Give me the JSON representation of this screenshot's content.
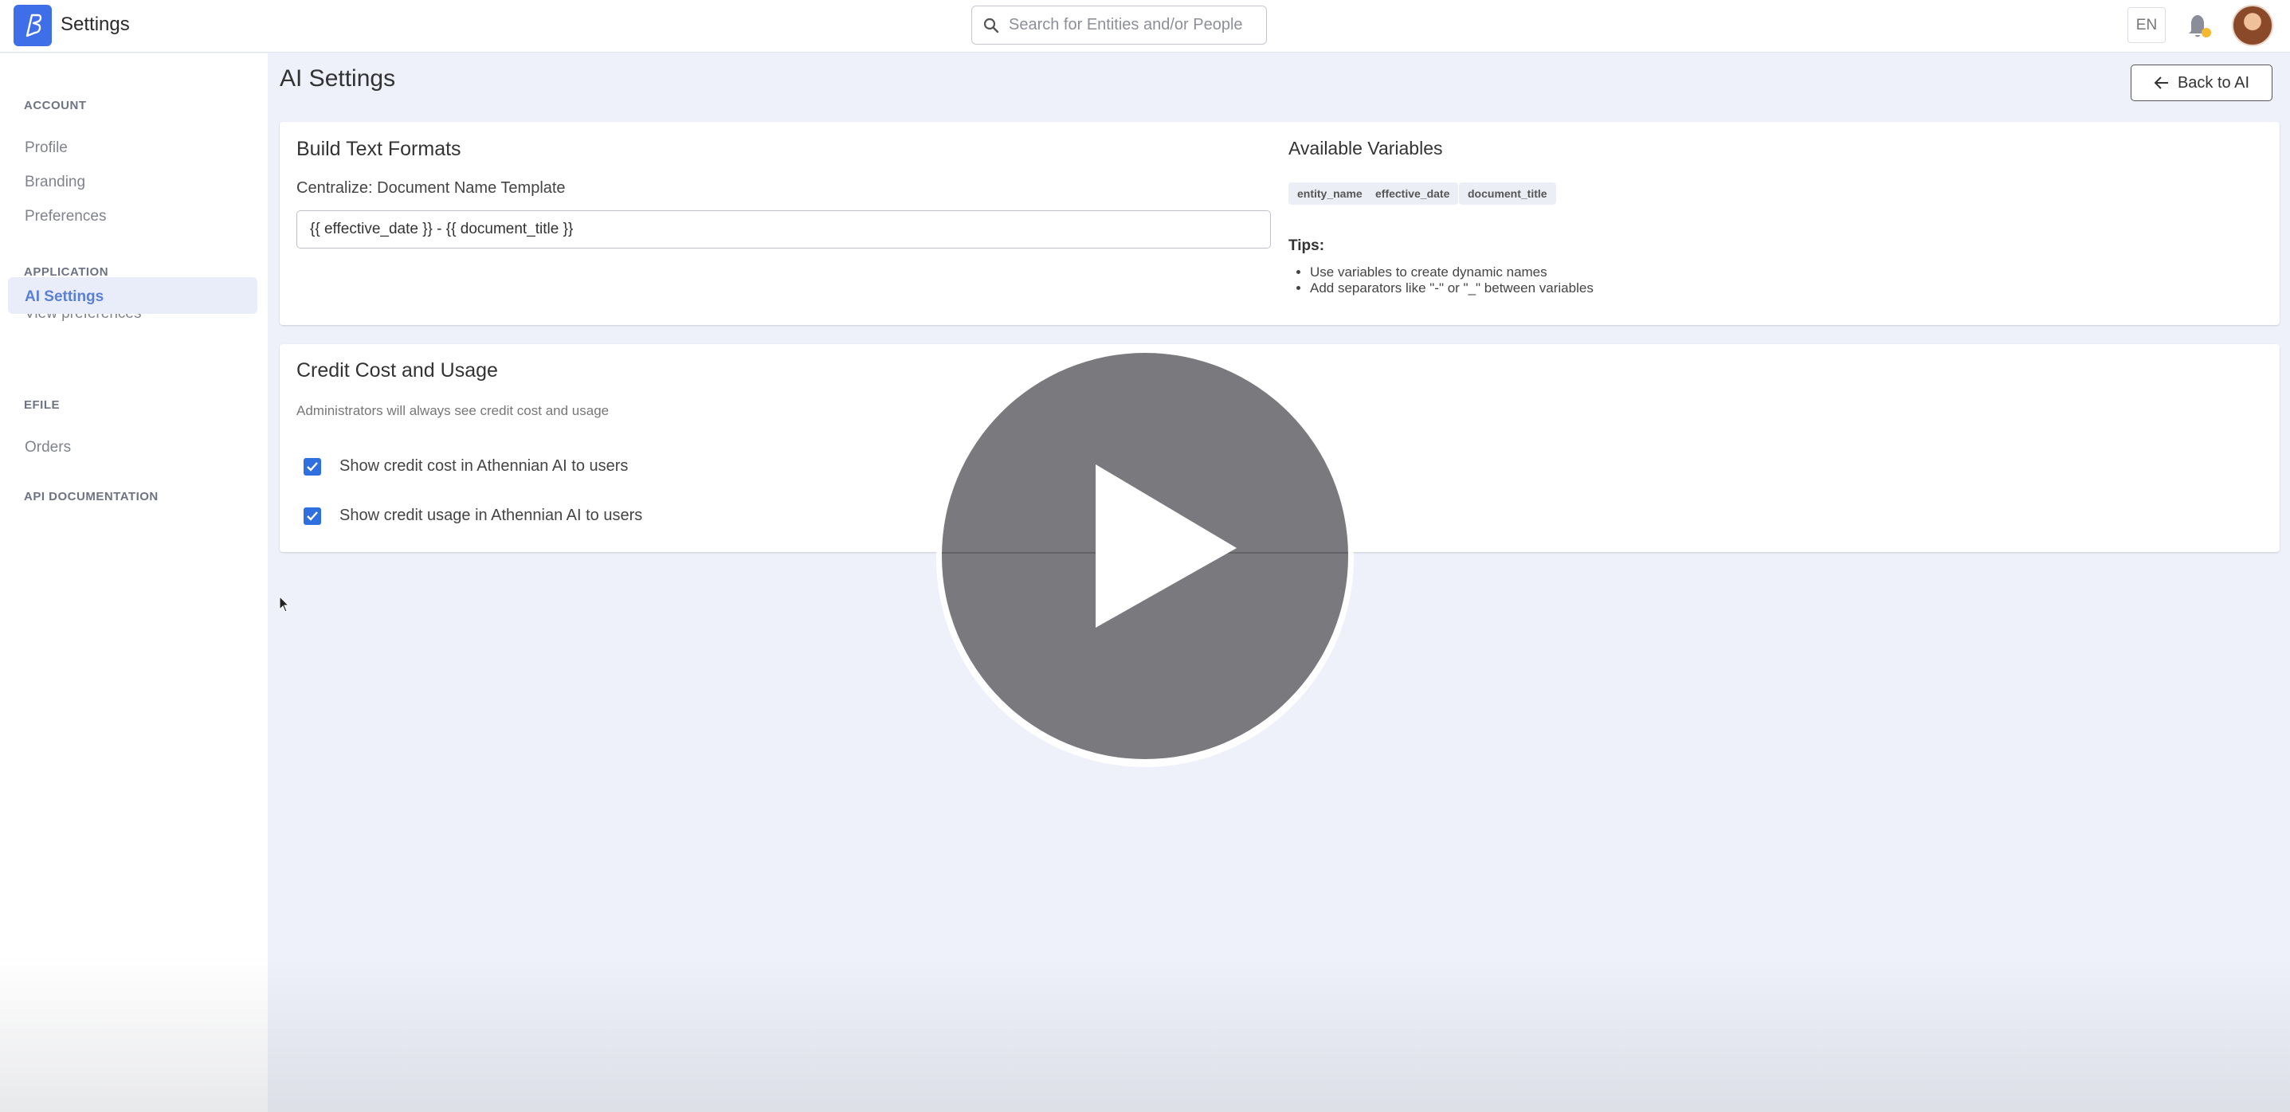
{
  "topbar": {
    "title": "Settings",
    "search_placeholder": "Search for Entities and/or People",
    "language": "EN"
  },
  "sidebar": {
    "sections": [
      {
        "label": "ACCOUNT"
      },
      {
        "label": "APPLICATION"
      },
      {
        "label": "EFILE"
      },
      {
        "label": "API DOCUMENTATION"
      }
    ],
    "items": [
      {
        "label": "Profile"
      },
      {
        "label": "Branding"
      },
      {
        "label": "Preferences"
      },
      {
        "label": "View preferences"
      },
      {
        "label": "AI Settings",
        "active": true
      },
      {
        "label": "Orders"
      }
    ]
  },
  "page": {
    "title": "AI Settings",
    "back_label": "Back to AI"
  },
  "build_formats": {
    "title": "Build Text Formats",
    "field_label": "Centralize: Document Name Template",
    "field_value": "{{ effective_date }} - {{ document_title }}",
    "variables_title": "Available Variables",
    "variables": [
      "entity_name",
      "effective_date",
      "document_title"
    ],
    "tips_title": "Tips:",
    "tips": [
      "Use variables to create dynamic names",
      "Add separators like \"-\" or \"_\" between variables"
    ]
  },
  "credit": {
    "title": "Credit Cost and Usage",
    "description": "Administrators will always see credit cost and usage",
    "options": [
      {
        "label": "Show credit cost in Athennian AI to users",
        "checked": true
      },
      {
        "label": "Show credit usage in Athennian AI to users",
        "checked": true
      }
    ]
  },
  "colors": {
    "brand": "#3f6fe8",
    "checkbox": "#2f6fe0",
    "active_nav": "#5a7fd8",
    "notification": "#f5b82e"
  }
}
